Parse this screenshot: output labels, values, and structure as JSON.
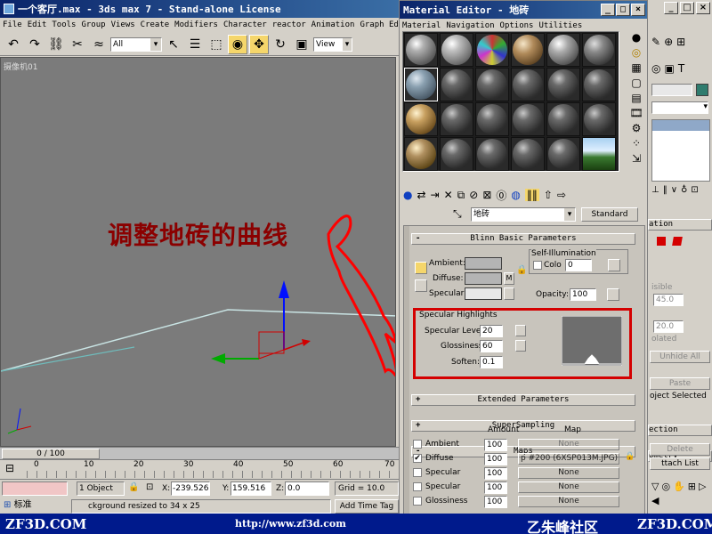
{
  "main_window": {
    "title": "一个客厅.max - 3ds max 7 - Stand-alone License",
    "menu": [
      "File",
      "Edit",
      "Tools",
      "Group",
      "Views",
      "Create",
      "Modifiers",
      "Character",
      "reactor",
      "Animation",
      "Graph Edito"
    ],
    "selection_filter": "All",
    "ref_coord": "View"
  },
  "viewport": {
    "label": "摄像机01",
    "annotation": "调整地砖的曲线",
    "annotation_color": "#8b0000"
  },
  "timeline": {
    "slider_label": "0 / 100",
    "ticks": [
      "0",
      "10",
      "20",
      "30",
      "40",
      "50",
      "60",
      "70"
    ]
  },
  "status": {
    "objects": "1 Object",
    "x_label": "X:",
    "x": "-239.526",
    "y_label": "Y:",
    "y": "159.516",
    "z_label": "Z:",
    "z": "0.0",
    "grid": "Grid = 10.0",
    "mode_label": "标准",
    "prompt": "ckground resized to 34 x 25",
    "add_time_tag": "Add Time Tag"
  },
  "material_editor": {
    "title": "Material Editor - 地砖",
    "menu": [
      "Material",
      "Navigation",
      "Options",
      "Utilities"
    ],
    "material_name": "地砖",
    "material_type": "Standard",
    "rollouts": {
      "blinn_basic": "Blinn Basic Parameters",
      "extended": "Extended Parameters",
      "supersampling": "SuperSampling",
      "maps": "Maps"
    },
    "blinn": {
      "ambient_label": "Ambient:",
      "diffuse_label": "Diffuse:",
      "specular_label": "Specular:",
      "lock_label": "M",
      "self_illum_label": "Self-Illumination",
      "color_label": "Colo",
      "self_illum_value": "0",
      "opacity_label": "Opacity:",
      "opacity_value": "100"
    },
    "specular_highlights": {
      "title": "Specular Highlights",
      "specular_level_label": "Specular Level:",
      "specular_level": "20",
      "glossiness_label": "Glossiness:",
      "glossiness": "60",
      "soften_label": "Soften:",
      "soften": "0.1",
      "highlight_color": "#d40000"
    },
    "maps": {
      "amount_header": "Amount",
      "map_header": "Map",
      "rows": [
        {
          "enabled": "",
          "name": "Ambient",
          "amount": "100",
          "map": "None"
        },
        {
          "enabled": "✔",
          "name": "Diffuse",
          "amount": "100",
          "map": "p #200 (6XSP013M.JPG)"
        },
        {
          "enabled": "",
          "name": "Specular",
          "amount": "100",
          "map": "None"
        },
        {
          "enabled": "",
          "name": "Specular",
          "amount": "100",
          "map": "None"
        },
        {
          "enabled": "",
          "name": "Glossiness",
          "amount": "100",
          "map": "None"
        }
      ]
    }
  },
  "command_panel": {
    "visible_label": "isible",
    "value_1": "45.0",
    "value_2": "20.0",
    "isolated_label": "olated",
    "unhide_all": "Unhide All",
    "paste": "Paste",
    "object_selected": "oject Selected",
    "section_1": "ection",
    "section_2": "ometry",
    "section_3": "ation",
    "attach_list": "ttach List",
    "delete": "Delete"
  },
  "footer": {
    "left_logo": "ZF3D.COM",
    "url": "http://www.zf3d.com",
    "community": "乙朱峰社区",
    "right_logo": "ZF3D.COM"
  }
}
